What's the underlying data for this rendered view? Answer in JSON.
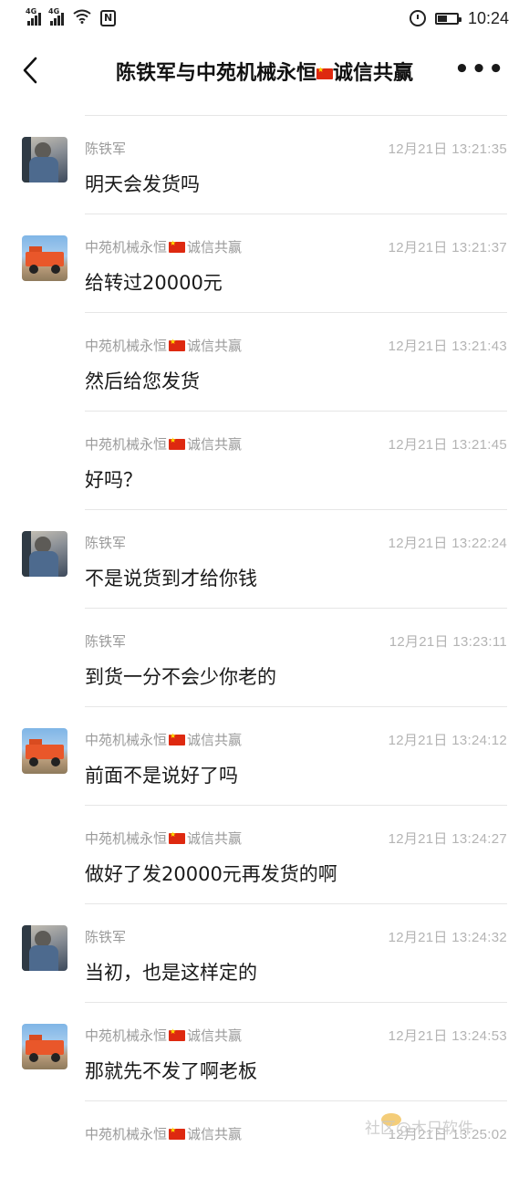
{
  "status": {
    "net1": "4G",
    "net2": "4G",
    "nfc": "N",
    "time": "10:24",
    "battery_level": 0.5
  },
  "nav": {
    "title_prefix": "陈铁军与中苑机械永恒",
    "title_suffix": "诚信共赢",
    "more_label": "•••"
  },
  "messages": [
    {
      "sender": "陈铁军",
      "flag": false,
      "time": "12月21日 13:21:35",
      "text": "明天会发货吗",
      "avatar": "chen"
    },
    {
      "sender": "中苑机械永恒",
      "sender_suffix": "诚信共赢",
      "flag": true,
      "time": "12月21日 13:21:37",
      "text": "给转过20000元",
      "avatar": "zy"
    },
    {
      "sender": "中苑机械永恒",
      "sender_suffix": "诚信共赢",
      "flag": true,
      "time": "12月21日 13:21:43",
      "text": "然后给您发货",
      "avatar": ""
    },
    {
      "sender": "中苑机械永恒",
      "sender_suffix": "诚信共赢",
      "flag": true,
      "time": "12月21日 13:21:45",
      "text": "好吗？",
      "avatar": ""
    },
    {
      "sender": "陈铁军",
      "flag": false,
      "time": "12月21日 13:22:24",
      "text": "不是说货到才给你钱",
      "avatar": "chen"
    },
    {
      "sender": "陈铁军",
      "flag": false,
      "time": "12月21日 13:23:11",
      "text": "到货一分不会少你老的",
      "avatar": ""
    },
    {
      "sender": "中苑机械永恒",
      "sender_suffix": "诚信共赢",
      "flag": true,
      "time": "12月21日 13:24:12",
      "text": "前面不是说好了吗",
      "avatar": "zy"
    },
    {
      "sender": "中苑机械永恒",
      "sender_suffix": "诚信共赢",
      "flag": true,
      "time": "12月21日 13:24:27",
      "text": "做好了发20000元再发货的啊",
      "avatar": ""
    },
    {
      "sender": "陈铁军",
      "flag": false,
      "time": "12月21日 13:24:32",
      "text": "当初，也是这样定的",
      "avatar": "chen"
    },
    {
      "sender": "中苑机械永恒",
      "sender_suffix": "诚信共赢",
      "flag": true,
      "time": "12月21日 13:24:53",
      "text": "那就先不发了啊老板",
      "avatar": "zy"
    },
    {
      "sender": "中苑机械永恒",
      "sender_suffix": "诚信共赢",
      "flag": true,
      "time": "12月21日 13:25:02",
      "text": "",
      "avatar": ""
    }
  ],
  "watermark": "社区@木只软件"
}
